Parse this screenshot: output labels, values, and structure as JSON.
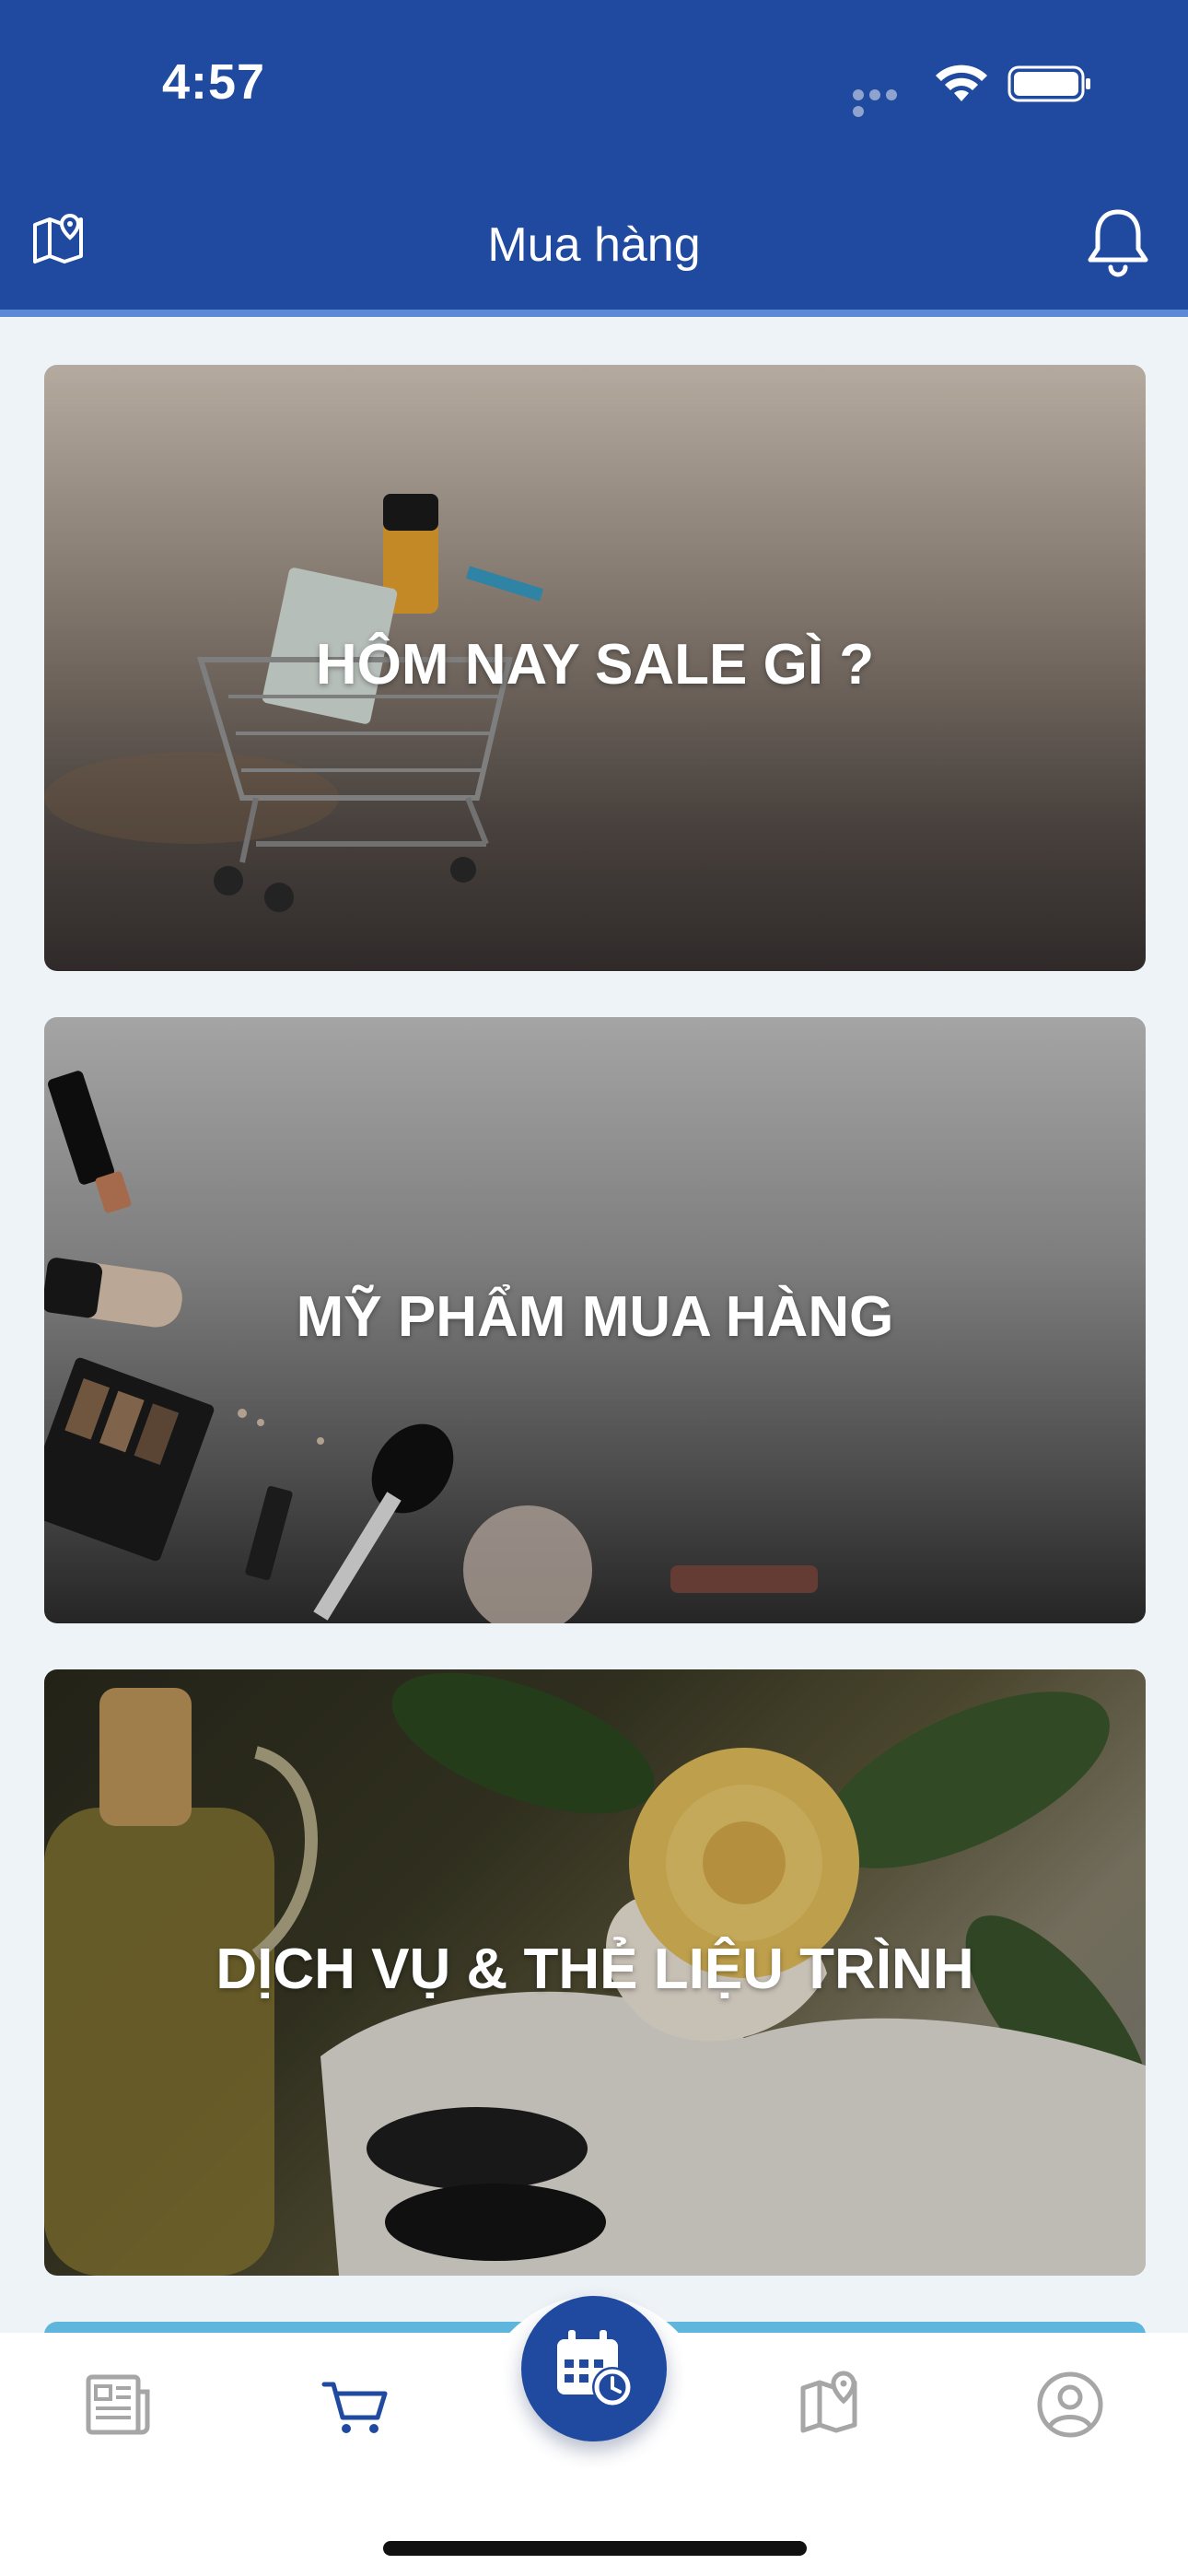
{
  "status_bar": {
    "time": "4:57"
  },
  "header": {
    "title": "Mua hàng"
  },
  "cards": [
    {
      "title": "HÔM NAY SALE GÌ ?"
    },
    {
      "title": "MỸ PHẨM MUA HÀNG"
    },
    {
      "title": "DỊCH VỤ & THẺ LIỆU TRÌNH"
    }
  ],
  "tab_bar": {
    "items": [
      {
        "icon": "newspaper-icon",
        "active": false
      },
      {
        "icon": "cart-icon",
        "active": true
      },
      {
        "icon": "calendar-clock-icon",
        "active": false
      },
      {
        "icon": "map-pin-icon",
        "active": false
      },
      {
        "icon": "user-circle-icon",
        "active": false
      }
    ]
  },
  "colors": {
    "primary": "#1f4aa0",
    "background": "#eef3f7",
    "tab_active": "#1f4aa0",
    "tab_inactive": "#a6a6a6"
  }
}
